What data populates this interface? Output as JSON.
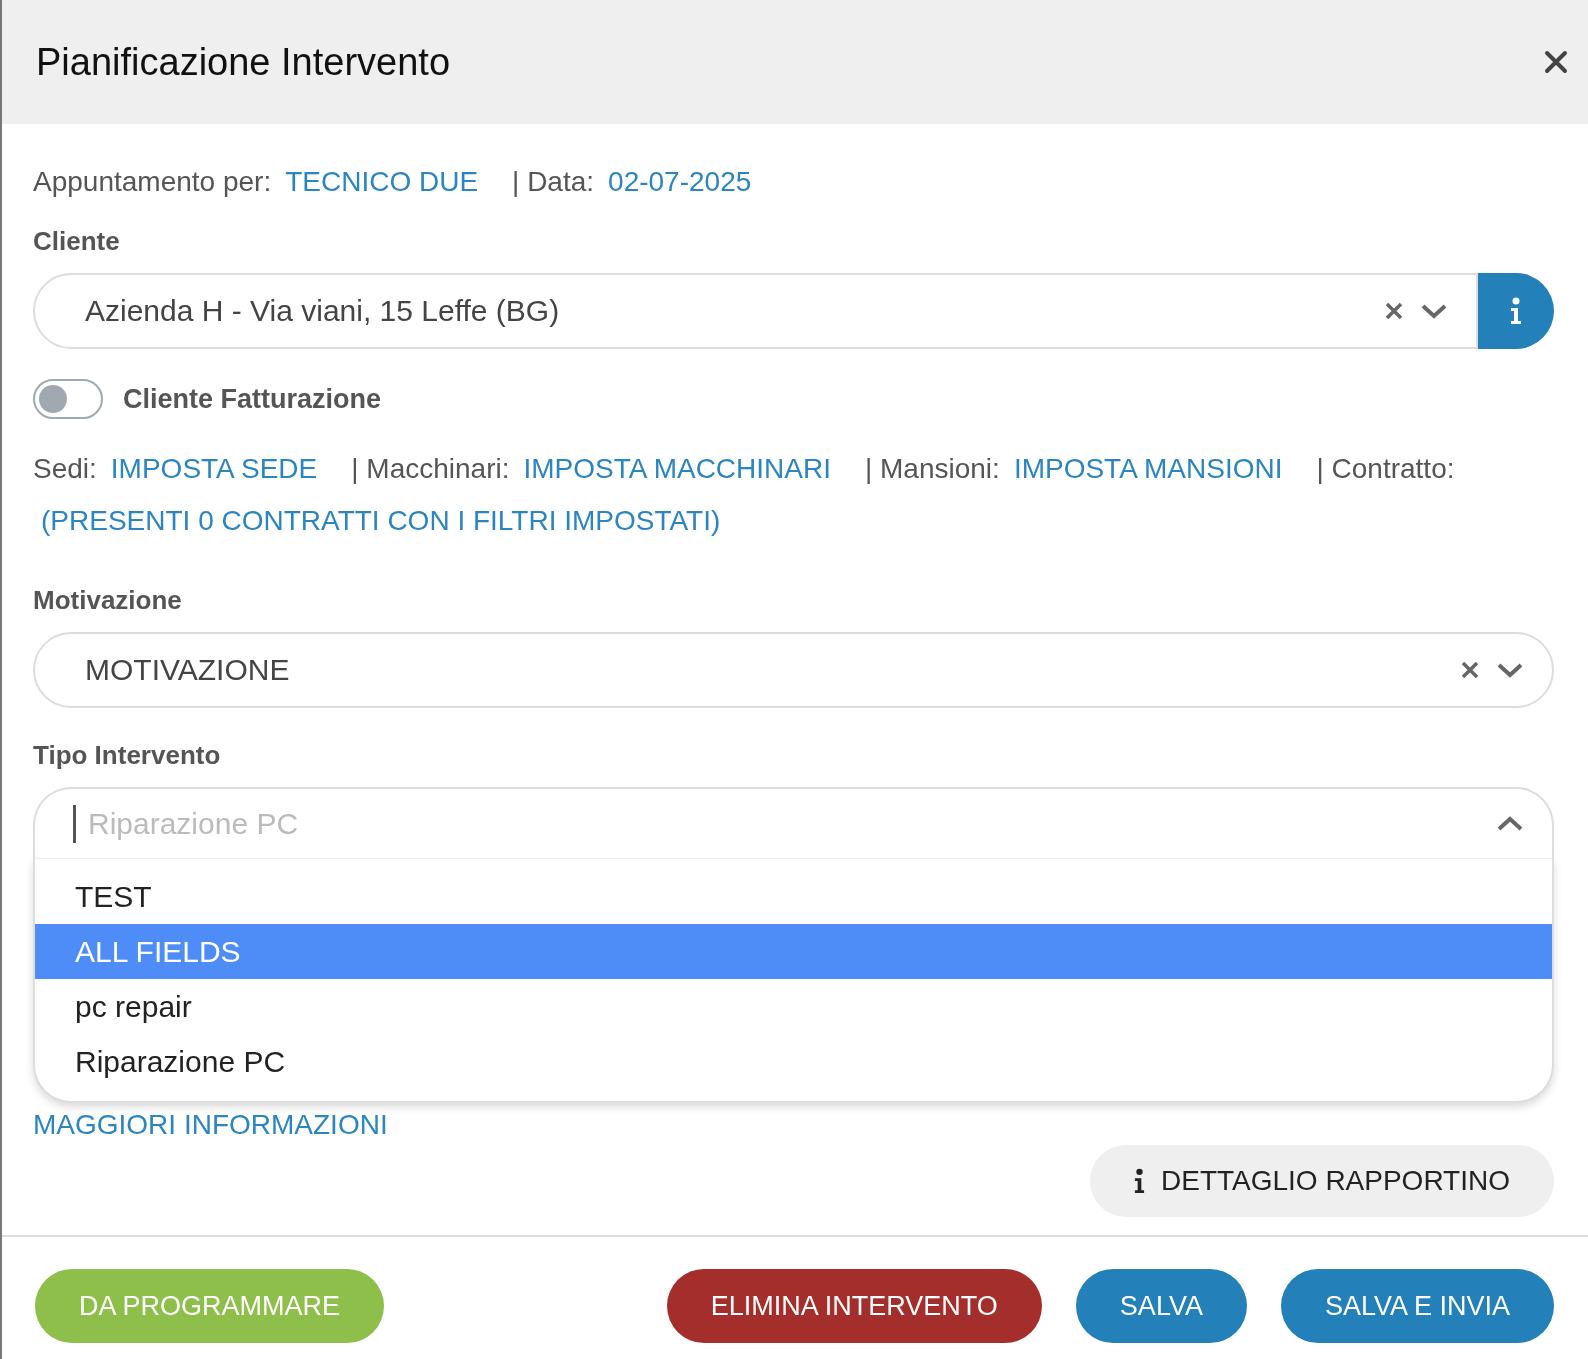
{
  "dialog": {
    "title": "Pianificazione Intervento"
  },
  "appointment": [
    {
      "label": "Appuntamento per:",
      "value": "TECNICO DUE"
    },
    {
      "label": "| Data:",
      "value": "02-07-2025"
    }
  ],
  "cliente": {
    "label": "Cliente",
    "value": "Azienda H - Via viani, 15 Leffe (BG)"
  },
  "billing_toggle": {
    "label": "Cliente Fatturazione",
    "on": false
  },
  "links": [
    {
      "label": "Sedi:",
      "value": "IMPOSTA SEDE"
    },
    {
      "label": "| Macchinari:",
      "value": "IMPOSTA MACCHINARI"
    },
    {
      "label": "| Mansioni:",
      "value": "IMPOSTA MANSIONI"
    },
    {
      "label": "| Contratto:"
    }
  ],
  "contract_note": "(PRESENTI 0 CONTRATTI CON I FILTRI IMPOSTATI)",
  "motivazione": {
    "label": "Motivazione",
    "value": "MOTIVAZIONE"
  },
  "tipo_intervento": {
    "label": "Tipo Intervento",
    "placeholder": "Riparazione PC",
    "expanded": true,
    "options": [
      {
        "label": "TEST",
        "selected": false
      },
      {
        "label": "ALL FIELDS",
        "selected": true
      },
      {
        "label": "pc repair",
        "selected": false
      },
      {
        "label": "Riparazione PC",
        "selected": false
      }
    ]
  },
  "more_info_link": "MAGGIORI INFORMAZIONI",
  "detail_button": "DETTAGLIO RAPPORTINO",
  "footer_buttons": [
    {
      "label": "DA PROGRAMMARE",
      "kind": "schedule"
    },
    {
      "label": "ELIMINA INTERVENTO",
      "kind": "danger"
    },
    {
      "label": "SALVA",
      "kind": "primary"
    },
    {
      "label": "SALVA E INVIA",
      "kind": "primary"
    }
  ]
}
